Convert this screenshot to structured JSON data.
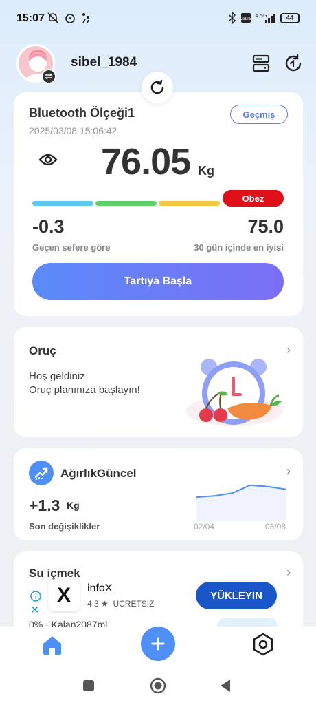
{
  "status_bar": {
    "time": "15:07",
    "battery": "44",
    "icons": [
      "muted-notifications-icon",
      "alarm-icon",
      "activity-icon",
      "bluetooth-icon",
      "volte-icon",
      "signal-4.5g-icon",
      "battery-icon"
    ]
  },
  "header": {
    "username": "sibel_1984",
    "icons": [
      "avatar",
      "switch-account-icon",
      "data-panel-icon",
      "refresh-icon"
    ]
  },
  "scale_card": {
    "device_name": "Bluetooth Ölçeği1",
    "timestamp": "2025/03/08 15:06:42",
    "history_label": "Geçmiş",
    "weight": "76.05",
    "unit": "Kg",
    "category_badge": "Obez",
    "bmi_bar_colors": [
      "#5bc8ef",
      "#5fcf6a",
      "#f3c840",
      "#e0101a"
    ],
    "change_value": "-0.3",
    "change_label": "Geçen sefere göre",
    "best_value": "75.0",
    "best_label": "30 gün içinde en iyisi",
    "start_button": "Tartıya Başla"
  },
  "fasting_card": {
    "title": "Oruç",
    "line1": "Hoş geldiniz",
    "line2": "Oruç planınıza başlayın!"
  },
  "weight_card": {
    "title": "AğırlıkGüncel",
    "change_value": "+1.3",
    "unit": "Kg",
    "subtitle": "Son değişiklikler",
    "x_start": "02/04",
    "x_end": "03/08"
  },
  "chart_data": {
    "type": "area",
    "title": "",
    "x": [
      "02/04",
      "03/08"
    ],
    "series": [
      {
        "values": [
          74.7,
          74.8,
          75.0,
          75.6,
          75.5,
          75.3
        ]
      }
    ],
    "grid": false
  },
  "water_card": {
    "title": "Su içmek",
    "progress_text": "0% · Kalan2087ml"
  },
  "ad": {
    "app_name": "infoX",
    "rating": "4.3 ★",
    "price": "ÜCRETSİZ",
    "install_button": "YÜKLEYIN",
    "logo_letter": "X"
  },
  "colors": {
    "accent": "#5b7cf7",
    "fab": "#4f8ff8",
    "danger": "#e0101a",
    "ad_button": "#1a56c8"
  }
}
